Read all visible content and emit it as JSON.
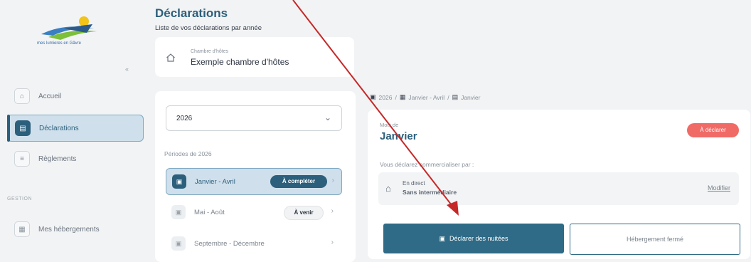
{
  "logo": {
    "tagline": "mes lumieres en Gâvre"
  },
  "sidebar": {
    "collapse_label": "«",
    "items": [
      {
        "label": "Accueil",
        "icon": "home-icon",
        "glyph": "⌂"
      },
      {
        "label": "Déclarations",
        "icon": "document-icon",
        "glyph": "▤"
      },
      {
        "label": "Règlements",
        "icon": "payment-icon",
        "glyph": "≡"
      }
    ],
    "section_label": "GESTION",
    "section_items": [
      {
        "label": "Mes hébergements",
        "icon": "building-icon",
        "glyph": "▦"
      }
    ]
  },
  "header": {
    "title": "Déclarations",
    "subtitle": "Liste de vos déclarations par année"
  },
  "host": {
    "type": "Chambre d'hôtes",
    "name": "Exemple chambre d'hôtes"
  },
  "periods": {
    "year": "2026",
    "label": "Périodes de 2026",
    "rows": [
      {
        "label": "Janvier - Avril",
        "badge": "À compléter",
        "glyph": "▣"
      },
      {
        "label": "Mai - Août",
        "badge": "À venir",
        "glyph": "▣"
      },
      {
        "label": "Septembre - Décembre",
        "badge": "",
        "glyph": "▣"
      }
    ],
    "chevron": "›"
  },
  "breadcrumb": {
    "items": [
      "2026",
      "Janvier - Avril",
      "Janvier"
    ],
    "separator": "/"
  },
  "month": {
    "small_label": "Mois de",
    "name": "Janvier",
    "status": "À déclarer",
    "declare_text": "Vous déclarez commercialiser par :",
    "channel_title": "En direct",
    "channel_sub": "Sans intermédiaire",
    "modify": "Modifier",
    "primary_button": "Déclarer des nuitées",
    "secondary_button": "Hébergement fermé"
  },
  "colors": {
    "accent": "#2c5f7c",
    "status_red": "#f06a66",
    "annotation_arrow": "#c62828"
  }
}
